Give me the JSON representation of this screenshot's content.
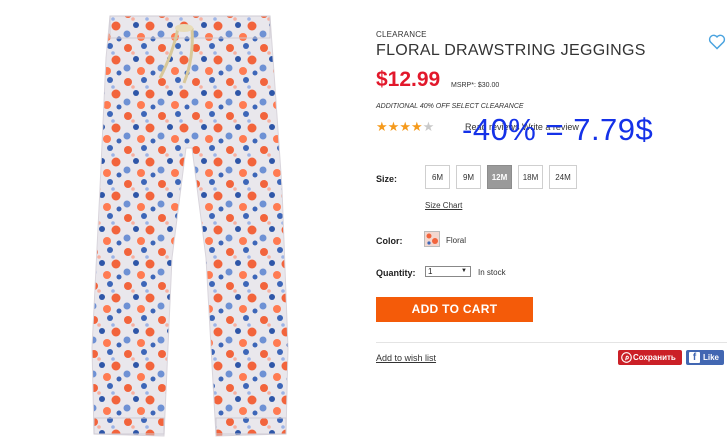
{
  "product": {
    "eyebrow": "CLEARANCE",
    "title": "FLORAL DRAWSTRING JEGGINGS",
    "price": "$12.99",
    "msrp": "MSRP*: $30.00",
    "promo": "ADDITIONAL 40% OFF SELECT CLEARANCE",
    "rating": 4,
    "rating_max": 5,
    "review_link": "Read reviews  Write a review",
    "overlay_discount": "-40% = 7.79$"
  },
  "size": {
    "label": "Size:",
    "options": [
      "6M",
      "9M",
      "12M",
      "18M",
      "24M"
    ],
    "selected": "12M",
    "chart_link": "Size Chart"
  },
  "color": {
    "label": "Color:",
    "name": "Floral"
  },
  "quantity": {
    "label": "Quantity:",
    "value": "1",
    "stock": "In stock"
  },
  "actions": {
    "add_to_cart": "ADD TO CART",
    "add_to_wishlist": "Add to wish list",
    "pinterest": "Сохранить",
    "facebook": "Like"
  },
  "colors": {
    "price_red": "#e2182b",
    "cta_orange": "#f45b09",
    "star_gold": "#f59a1c",
    "overlay_blue": "#1431e8",
    "wish_heart": "#4aa3df",
    "pinterest_red": "#cb2027",
    "facebook_blue": "#4267b2"
  },
  "icons": [
    "heart-icon",
    "star-icon",
    "pinterest-icon",
    "facebook-icon",
    "dropdown-caret-icon"
  ]
}
